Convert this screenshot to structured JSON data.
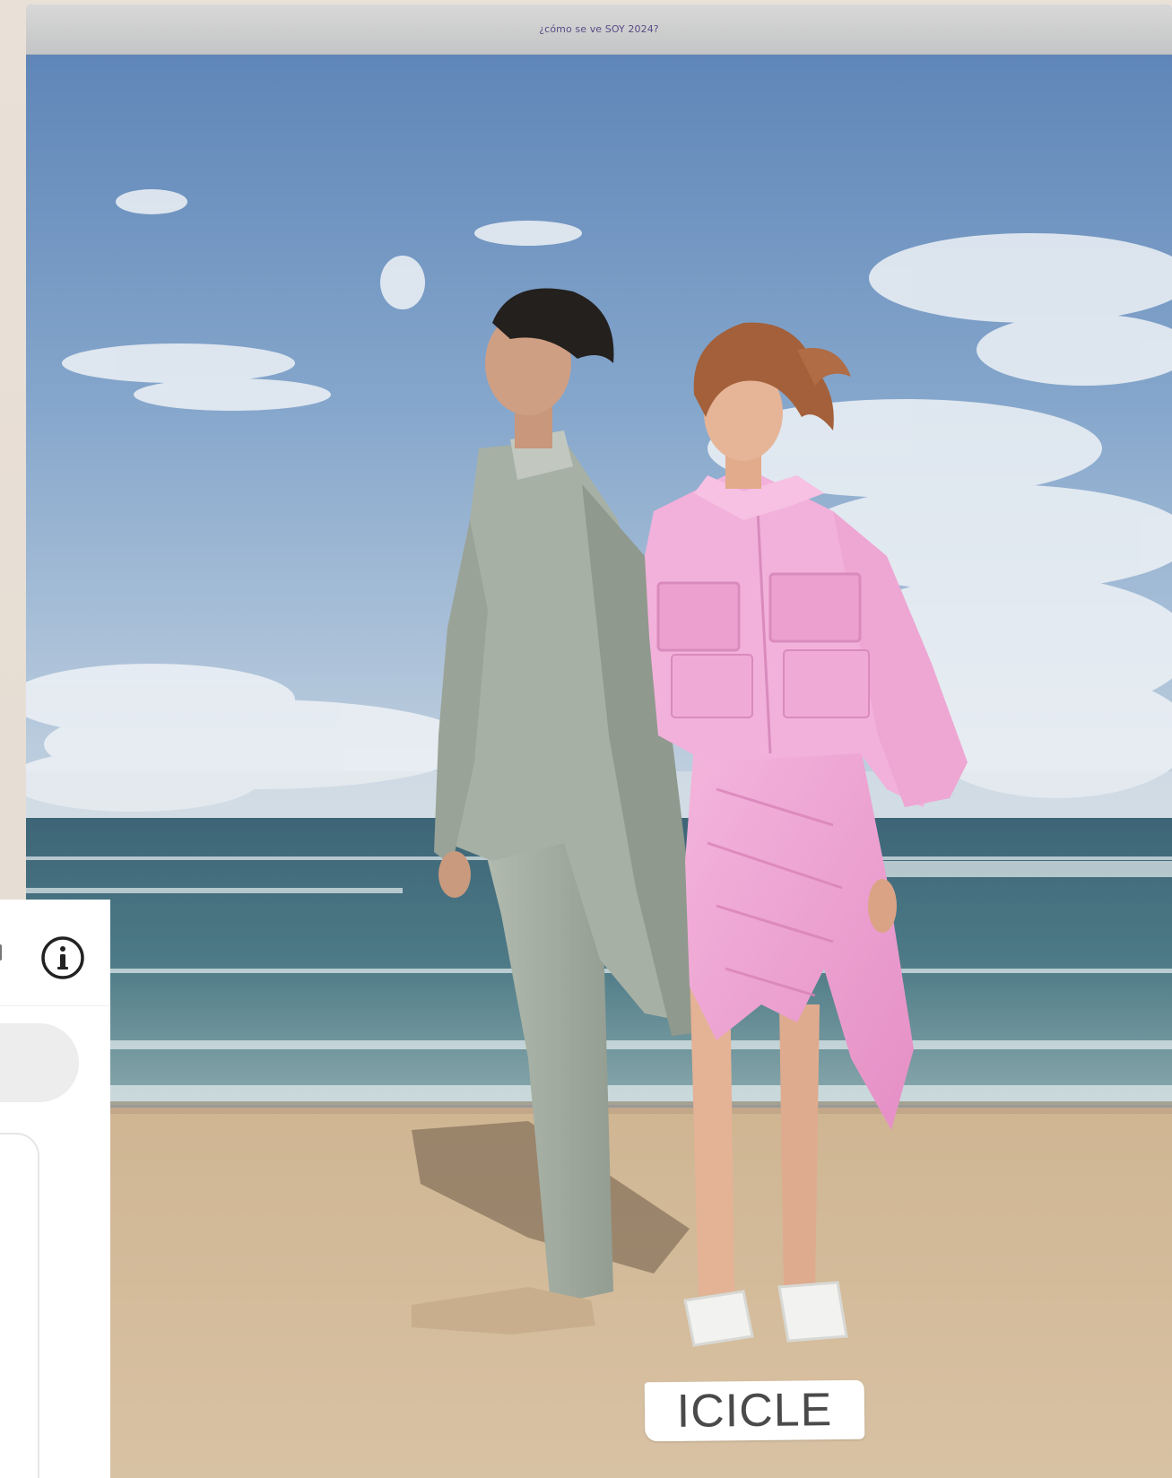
{
  "window": {
    "title": "¿cómo se ve SOY 2024?"
  },
  "photo": {
    "brand_label": "ICICLE"
  },
  "side_panel": {
    "info_icon": "info-icon"
  },
  "colors": {
    "title_text": "#5a4c87",
    "title_bar": "#cfd0d1",
    "sky": "#6f91bd",
    "sea": "#3f6f7e",
    "sand": "#d8c0a0",
    "pink_outfit": "#f0a8d6",
    "sage_outfit": "#a9b3a6"
  }
}
